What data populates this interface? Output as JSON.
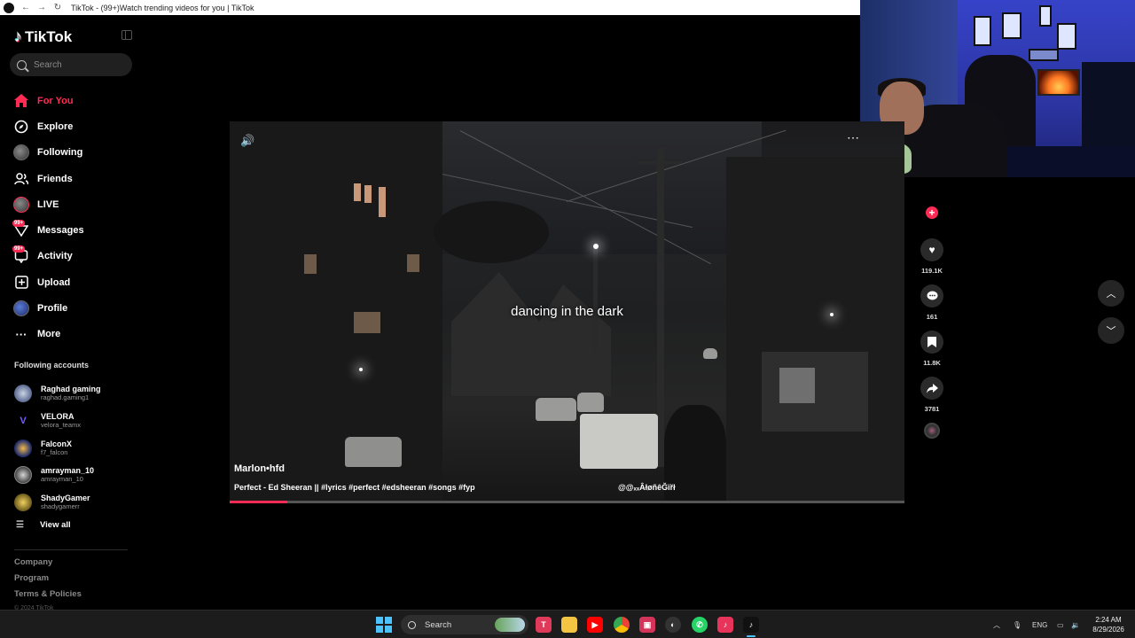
{
  "browser": {
    "tab_title": "TikTok - (99+)Watch trending videos for you | TikTok"
  },
  "sidebar": {
    "logo": "TikTok",
    "search_placeholder": "Search",
    "nav": [
      {
        "label": "For You",
        "icon": "home-icon",
        "active": true
      },
      {
        "label": "Explore",
        "icon": "compass-icon"
      },
      {
        "label": "Following",
        "icon": "avatar-icon"
      },
      {
        "label": "Friends",
        "icon": "friends-icon"
      },
      {
        "label": "LIVE",
        "icon": "live-avatar-icon"
      },
      {
        "label": "Messages",
        "icon": "messages-icon",
        "badge": "99+"
      },
      {
        "label": "Activity",
        "icon": "activity-icon",
        "badge": "99+"
      },
      {
        "label": "Upload",
        "icon": "upload-icon"
      },
      {
        "label": "Profile",
        "icon": "profile-avatar-icon"
      },
      {
        "label": "More",
        "icon": "more-dots-icon"
      }
    ],
    "following_title": "Following accounts",
    "accounts": [
      {
        "name": "Raghad gaming",
        "handle": "raghad.gaming1"
      },
      {
        "name": "VELORA",
        "handle": "velora_teamx"
      },
      {
        "name": "FalconX",
        "handle": "f7_falcon"
      },
      {
        "name": "amrayman_10",
        "handle": "amrayman_10"
      },
      {
        "name": "ShadyGamer",
        "handle": "shadygamerr"
      }
    ],
    "view_all": "View all",
    "footer": [
      "Company",
      "Program",
      "Terms & Policies"
    ],
    "copyright": "© 2024 TikTok"
  },
  "video": {
    "caption": "dancing in the dark",
    "author": "Marlon•hfd",
    "description": "Perfect - Ed Sheeran || #lyrics #perfect #edsheeran #songs #fyp",
    "sound": "@@ₓₓÂłøñêĞïřł",
    "progress": 0.085
  },
  "actions": {
    "likes": "119.1K",
    "comments": "161",
    "saves": "11.8K",
    "shares": "3781"
  },
  "taskbar": {
    "search_label": "Search",
    "language": "ENG",
    "time": "2:24 AM",
    "date": "8/29/2026"
  },
  "colors": {
    "accent": "#fe2c55",
    "background": "#000000"
  }
}
